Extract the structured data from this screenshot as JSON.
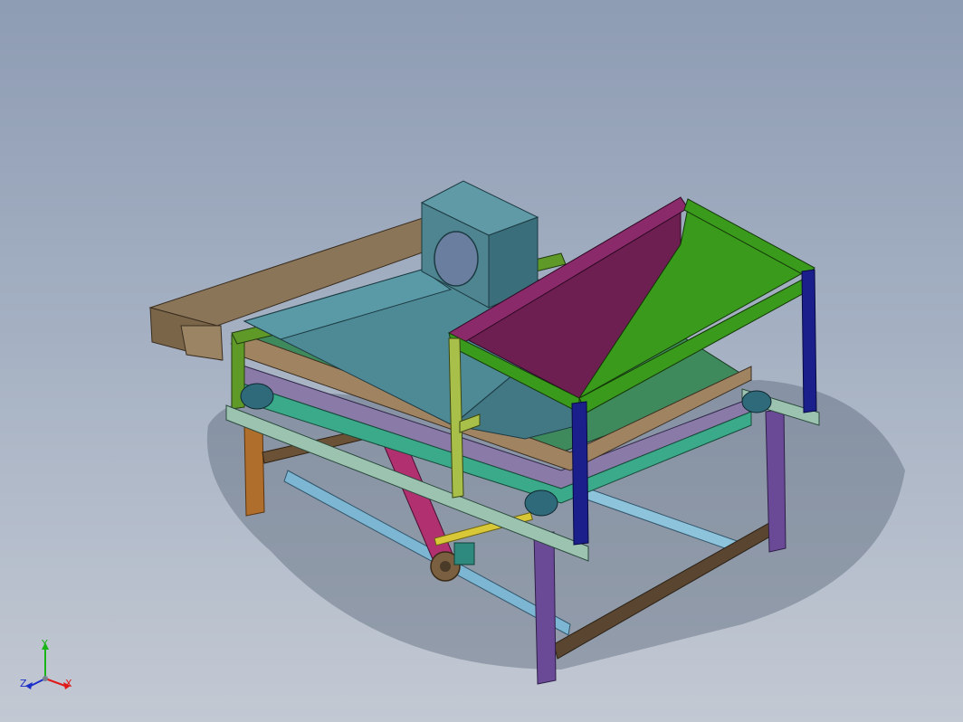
{
  "viewport": {
    "background_top": "#8e9cb4",
    "background_bottom": "#c3c9d3",
    "model_name_icon": "cad-assembly-icon"
  },
  "triad": {
    "x_label": "X",
    "y_label": "Y",
    "z_label": "Z",
    "x_color": "#e01818",
    "y_color": "#18b418",
    "z_color": "#1c2ec8"
  },
  "model_colors": {
    "hopper_magenta": "#6e1f52",
    "hopper_green": "#3a9a1c",
    "frame_blue": "#1a1f8c",
    "hood_teal": "#4e8a96",
    "chute_brown": "#8a7558",
    "leg_orange": "#b06e2c",
    "leg_purple": "#6a4a96",
    "rail_lightblue": "#7cb6d2",
    "rail_brown": "#5a4630"
  }
}
